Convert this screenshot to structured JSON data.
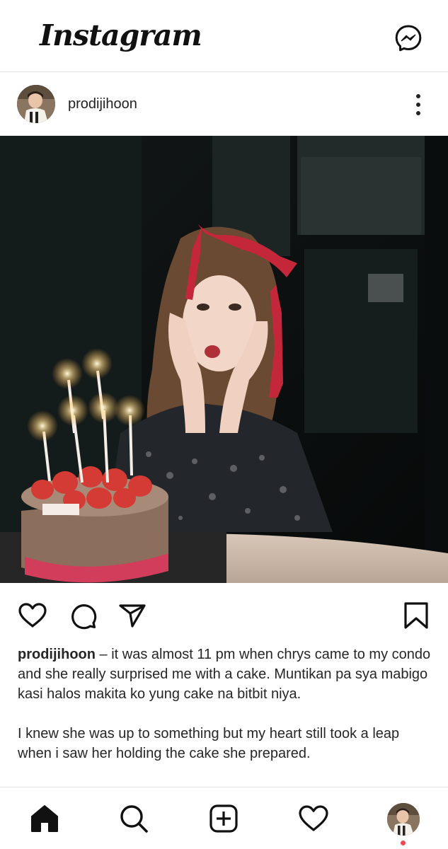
{
  "app": {
    "logo_text": "Instagram"
  },
  "header": {
    "messenger_icon": "messenger-icon"
  },
  "post": {
    "username": "prodijihoon",
    "more_icon": "more-vertical-icon",
    "photo_description_icon": "photo",
    "actions": {
      "like_icon": "heart-icon",
      "comment_icon": "comment-icon",
      "share_icon": "send-icon",
      "save_icon": "bookmark-icon"
    },
    "caption": {
      "username": "prodijihoon",
      "text_1": " – it was almost 11 pm when chrys came to my condo and she really surprised me with a cake. Muntikan pa sya mabigo kasi halos makita ko yung cake na bitbit niya.",
      "text_2": "I knew she was up to something but my heart still took a leap when i saw her holding the cake she prepared."
    }
  },
  "bottom_nav": {
    "items": [
      {
        "name": "home",
        "icon": "home-icon"
      },
      {
        "name": "search",
        "icon": "search-icon"
      },
      {
        "name": "new-post",
        "icon": "plus-square-icon"
      },
      {
        "name": "activity",
        "icon": "heart-icon"
      },
      {
        "name": "profile",
        "icon": "avatar"
      }
    ]
  },
  "colors": {
    "notification_dot": "#ed4956",
    "text": "#262626",
    "divider": "#e3e3e3"
  }
}
